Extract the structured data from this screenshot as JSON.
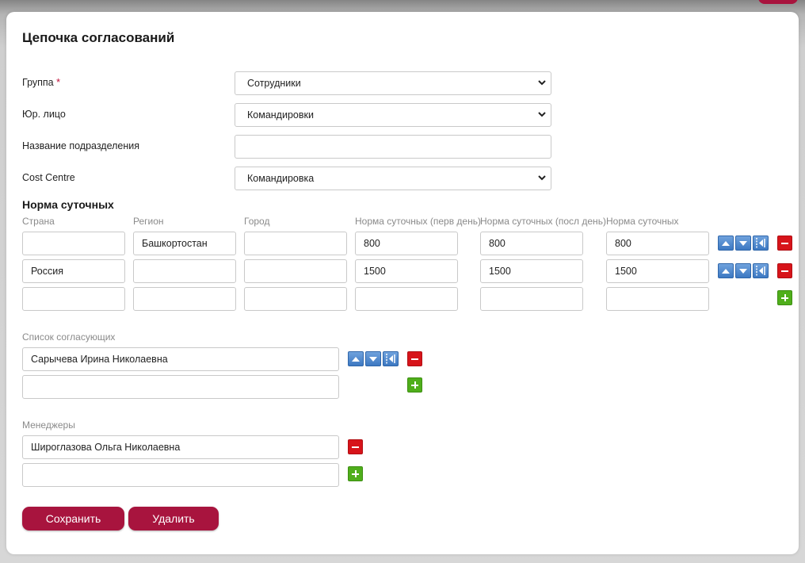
{
  "form": {
    "title": "Цепочка согласований",
    "fields": {
      "group": {
        "label": "Группа",
        "required_mark": "*",
        "value": "Сотрудники"
      },
      "legal_entity": {
        "label": "Юр. лицо",
        "value": "Командировки"
      },
      "department": {
        "label": "Название подразделения",
        "value": ""
      },
      "cost_centre": {
        "label": "Cost Centre",
        "value": "Командировка"
      }
    }
  },
  "per_diem": {
    "title": "Норма суточных",
    "columns": [
      "Страна",
      "Регион",
      "Город",
      "Норма суточных (перв день)",
      "Норма суточных (посл день)",
      "Норма суточных"
    ],
    "rows": [
      [
        "",
        "Башкортостан",
        "",
        "800",
        "800",
        "800"
      ],
      [
        "Россия",
        "",
        "",
        "1500",
        "1500",
        "1500"
      ],
      [
        "",
        "",
        "",
        "",
        "",
        ""
      ]
    ]
  },
  "approvers": {
    "title": "Список согласующих",
    "items": [
      "Сарычева Ирина Николаевна",
      ""
    ]
  },
  "managers": {
    "title": "Менеджеры",
    "items": [
      "Широглазова Ольга Николаевна",
      ""
    ]
  },
  "actions": {
    "save_label": "Сохранить",
    "delete_label": "Удалить"
  },
  "colors": {
    "accent": "#a8143e",
    "delete": "#d7141a",
    "add": "#4fae1b",
    "move": "#3c78c2"
  }
}
